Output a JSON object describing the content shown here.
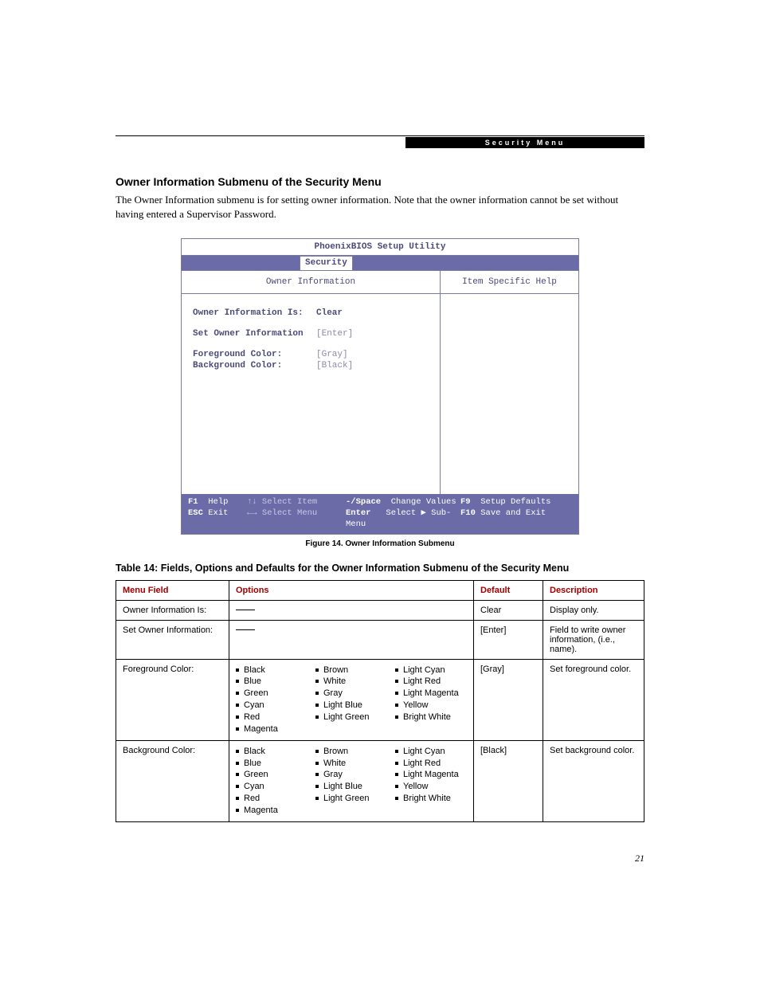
{
  "header": {
    "label": "Security Menu"
  },
  "section": {
    "title": "Owner Information Submenu of the Security Menu",
    "intro": "The Owner Information submenu is for setting owner information. Note that the owner information cannot be set without having entered a Supervisor Password."
  },
  "bios": {
    "title": "PhoenixBIOS Setup Utility",
    "tab": "Security",
    "left_heading": "Owner Information",
    "right_heading": "Item Specific Help",
    "fields": {
      "owner_info_is": {
        "label": "Owner Information Is:",
        "value": "Clear"
      },
      "set_owner_info": {
        "label": "Set Owner Information",
        "value": "[Enter]"
      },
      "fg_color": {
        "label": "Foreground Color:",
        "value": "[Gray]"
      },
      "bg_color": {
        "label": "Background Color:",
        "value": "[Black]"
      }
    },
    "footer": {
      "f1": "F1",
      "f1_label": "Help",
      "esc": "ESC",
      "esc_label": "Exit",
      "updown": "↑↓",
      "updown_label": "Select Item",
      "leftright": "←→",
      "leftright_label": "Select Menu",
      "space": "-/Space",
      "space_label": "Change Values",
      "enter": "Enter",
      "enter_label": "Select ▶ Sub-Menu",
      "f9": "F9",
      "f9_label": "Setup Defaults",
      "f10": "F10",
      "f10_label": "Save and Exit"
    }
  },
  "figure_caption": "Figure 14.   Owner Information Submenu",
  "table_title": "Table 14: Fields, Options and Defaults for the Owner Information Submenu of the Security Menu",
  "table": {
    "headers": {
      "menu": "Menu Field",
      "options": "Options",
      "default": "Default",
      "desc": "Description"
    },
    "rows": [
      {
        "menu": "Owner Information Is:",
        "options_type": "dash",
        "default": "Clear",
        "desc": "Display only."
      },
      {
        "menu": "Set Owner Information:",
        "options_type": "dash",
        "default": "[Enter]",
        "desc": "Field to write owner information, (i.e., name)."
      },
      {
        "menu": "Foreground Color:",
        "options_type": "colors",
        "default": "[Gray]",
        "desc": "Set foreground color."
      },
      {
        "menu": "Background Color:",
        "options_type": "colors",
        "default": "[Black]",
        "desc": "Set background color."
      }
    ],
    "color_cols": [
      [
        "Black",
        "Blue",
        "Green",
        "Cyan",
        "Red",
        "Magenta"
      ],
      [
        "Brown",
        "White",
        "Gray",
        "Light Blue",
        "Light Green"
      ],
      [
        "Light Cyan",
        "Light Red",
        "Light Magenta",
        "Yellow",
        "Bright White"
      ]
    ]
  },
  "page_number": "21"
}
